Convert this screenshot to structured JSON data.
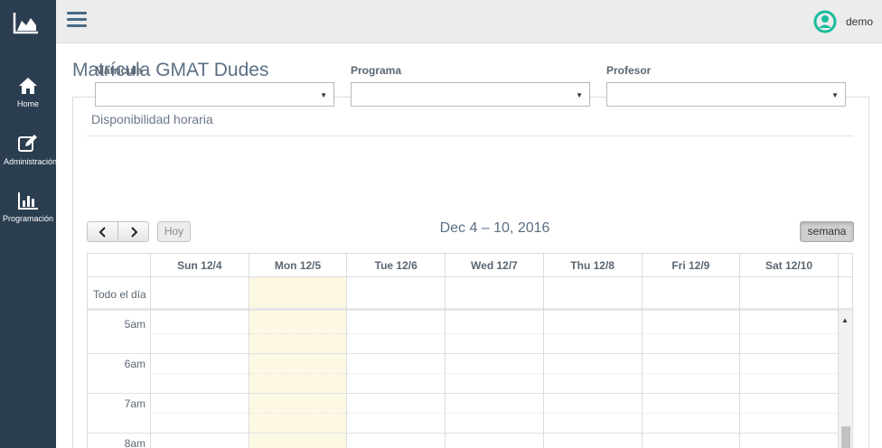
{
  "sidebar": {
    "logo_icon": "area-chart-icon",
    "items": [
      {
        "label": "Home",
        "icon": "home-icon"
      },
      {
        "label": "Administración",
        "icon": "edit-icon"
      },
      {
        "label": "Programación",
        "icon": "bar-chart-icon"
      }
    ]
  },
  "topbar": {
    "menu_icon": "hamburger-icon",
    "username": "demo",
    "avatar_icon": "user-circle-icon",
    "accent": "#1abc9c"
  },
  "page": {
    "title": "Matrícula GMAT Dudes"
  },
  "panel": {
    "title": "Disponibilidad horaria",
    "filters": [
      {
        "label": "Matrícula",
        "value": ""
      },
      {
        "label": "Programa",
        "value": ""
      },
      {
        "label": "Profesor",
        "value": ""
      }
    ]
  },
  "calendar": {
    "prev_label": "<",
    "next_label": ">",
    "today_label": "Hoy",
    "range_title": "Dec 4 – 10, 2016",
    "view_label": "semana",
    "allday_label": "Todo el día",
    "days": [
      "Sun 12/4",
      "Mon 12/5",
      "Tue 12/6",
      "Wed 12/7",
      "Thu 12/8",
      "Fri 12/9",
      "Sat 12/10"
    ],
    "today_index": 1,
    "hours": [
      "5am",
      "6am",
      "7am",
      "8am"
    ],
    "today_color": "#fcf8e3"
  }
}
